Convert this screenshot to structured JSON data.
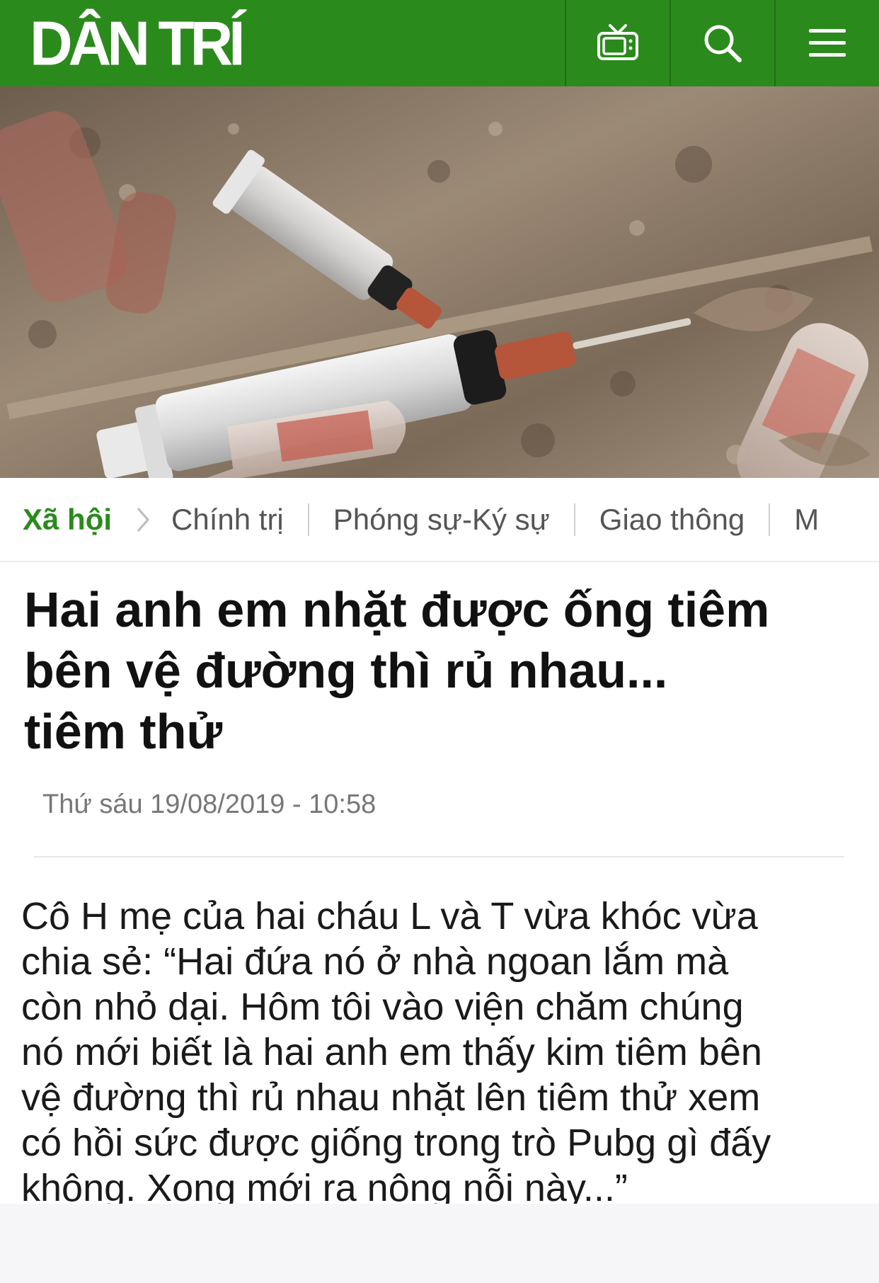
{
  "header": {
    "logo_text": "DÂN TRÍ",
    "background_color": "#2b8a1c",
    "icons": [
      "tv-icon",
      "search-icon",
      "menu-icon"
    ]
  },
  "nav": {
    "active": "Xã hội",
    "items": [
      "Chính trị",
      "Phóng sự-Ký sự",
      "Giao thông",
      "M"
    ],
    "active_color": "#2b8a1c"
  },
  "article": {
    "title_lines": [
      "Hai anh em nhặt được ống tiêm",
      "bên vệ đường thì rủ nhau...",
      "tiêm thử"
    ],
    "date": "Thứ sáu 19/08/2019 - 10:58",
    "body_lines": [
      "Cô H mẹ của hai cháu L và T vừa khóc vừa",
      "chia sẻ: “Hai đứa nó ở nhà ngoan lắm mà",
      "còn nhỏ dại. Hôm tôi vào viện chăm chúng",
      "nó mới biết là hai anh em thấy kim tiêm bên",
      "vệ đường thì rủ nhau nhặt lên tiêm thử xem",
      "có hồi sức được giống trong trò Pubg gì đấy",
      "không. Xong mới ra nông nỗi này...”"
    ]
  }
}
